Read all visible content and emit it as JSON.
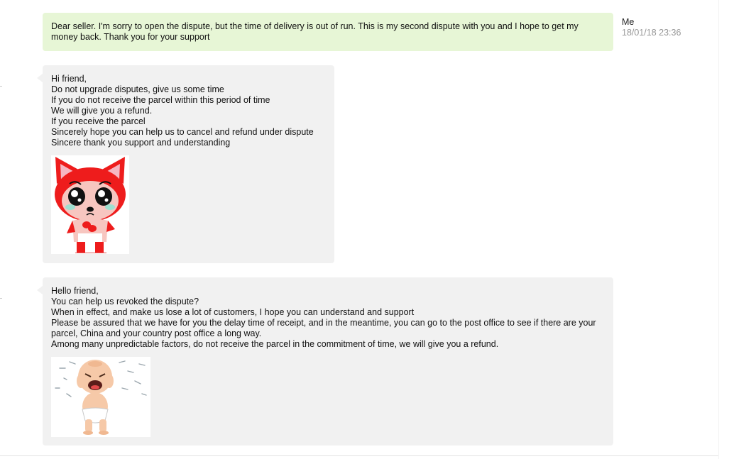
{
  "conversation": {
    "messages": [
      {
        "sender": "Me",
        "timestamp": "18/01/18 23:36",
        "lines": [
          "Dear seller.  I'm sorry to open the dispute, but the time of delivery is out of run.  This is my second dispute with you and I hope to get my money back.  Thank you for your support"
        ]
      },
      {
        "lines": [
          "Hi friend,",
          "Do not upgrade disputes, give us some time",
          "If you do not receive the parcel within this period of time",
          "We will give you a refund.",
          "If you receive the parcel",
          "Sincerely hope you can help us to cancel and refund under dispute",
          "Sincere thank you support and understanding"
        ],
        "attachment_icon": "crying-red-fox-sticker"
      },
      {
        "lines": [
          "Hello friend,",
          "You can help us revoked the dispute?",
          "When in effect, and make us lose a lot of customers, I hope you can understand and support",
          "Please be assured that we have for you the delay time of receipt, and in the meantime, you can go to the post office to see if there are your parcel, China and your country post office a long way.",
          "Among many unpredictable factors, do not receive the parcel in the commitment of time, we will give you a refund."
        ],
        "attachment_icon": "crying-baby-sticker"
      }
    ]
  },
  "colors": {
    "own_bubble": "#e7f6d6",
    "other_bubble": "#f1f1f1",
    "timestamp_text": "#999999",
    "body_text": "#111111"
  }
}
